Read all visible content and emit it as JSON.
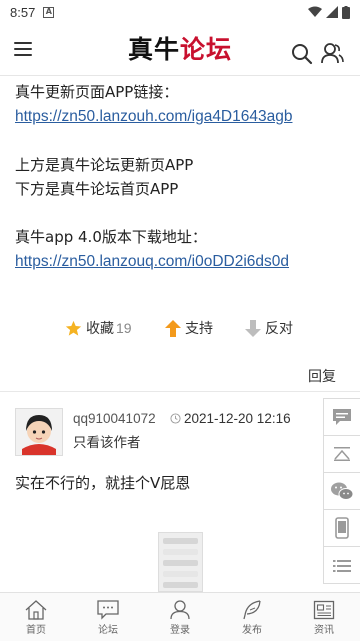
{
  "status_bar": {
    "time": "8:57",
    "badge": "A"
  },
  "header": {
    "logo_part1": "真牛",
    "logo_part2": "论坛",
    "logo_color": "#c8102e"
  },
  "post": {
    "lines": [
      "真牛更新页面APP链接：",
      "",
      "",
      "上方是真牛论坛更新页APP",
      "下方是真牛论坛首页APP",
      "",
      "真牛app 4.0版本下载地址：",
      ""
    ],
    "link1": "https://zn50.lanzouh.com/iga4D1643agb",
    "link2": "https://zn50.lanzouq.com/i0oDD2i6ds0d"
  },
  "actions": {
    "favorite_label": "收藏",
    "favorite_count": "19",
    "support_label": "支持",
    "oppose_label": "反对"
  },
  "reply_label": "回复",
  "comment": {
    "username": "qq910041072",
    "time": "2021-12-20 12:16",
    "only_author": "只看该作者",
    "text": "实在不行的，就挂个V屁恩"
  },
  "tabs": [
    {
      "label": "首页",
      "icon": "home-icon"
    },
    {
      "label": "论坛",
      "icon": "chat-icon"
    },
    {
      "label": "登录",
      "icon": "user-icon"
    },
    {
      "label": "发布",
      "icon": "feather-icon"
    },
    {
      "label": "资讯",
      "icon": "news-icon"
    }
  ],
  "side_tools": [
    "comment-icon",
    "back-to-top-icon",
    "wechat-icon",
    "mobile-icon",
    "list-icon"
  ]
}
